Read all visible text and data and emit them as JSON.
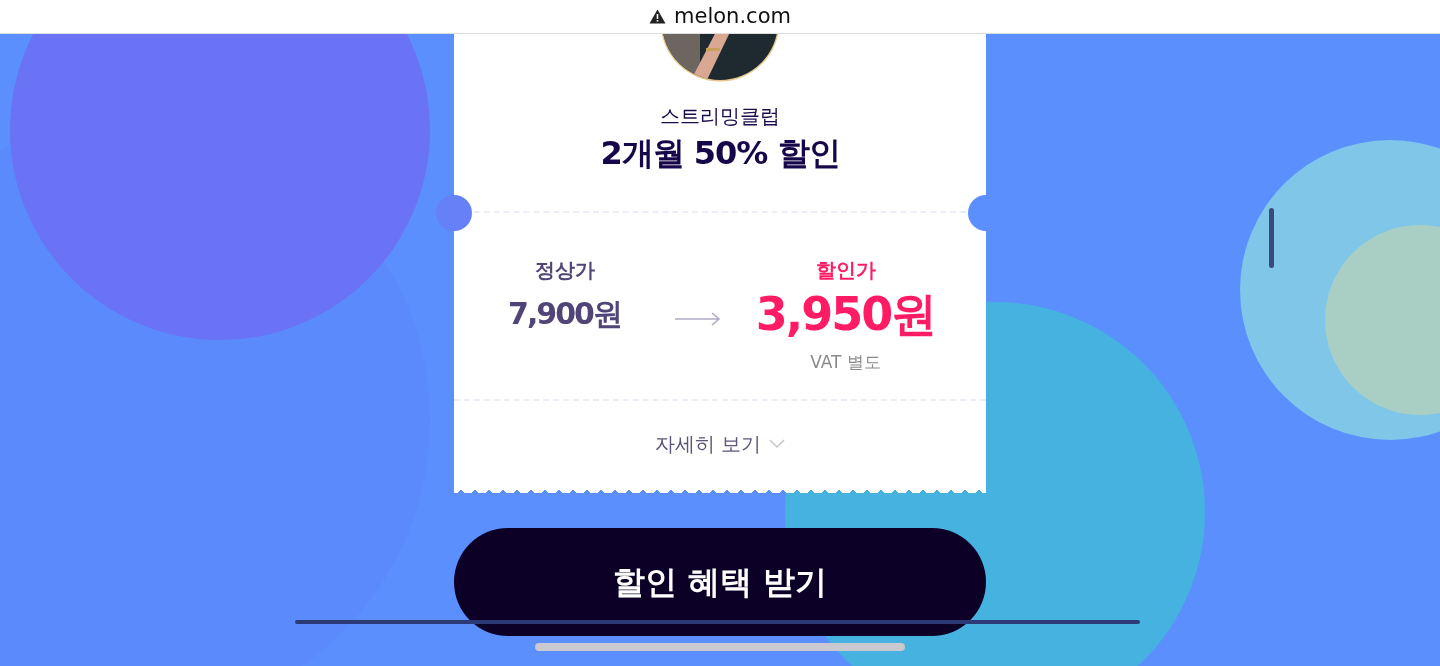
{
  "address_bar": {
    "warning": true,
    "url": "melon.com"
  },
  "card": {
    "subtitle": "스트리밍클럽",
    "title": "2개월 50% 할인",
    "regular": {
      "label": "정상가",
      "price": "7,900원"
    },
    "discount": {
      "label": "할인가",
      "price": "3,950원",
      "note": "VAT 별도"
    },
    "details_link": {
      "label": "자세히 보기",
      "expanded": false
    }
  },
  "cta_button": {
    "label": "할인 혜택 받기"
  }
}
